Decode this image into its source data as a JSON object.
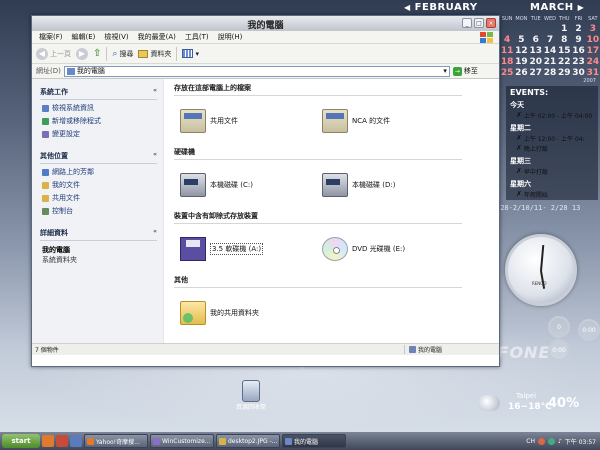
{
  "calendar": {
    "feb": {
      "month": "FEBRUARY"
    },
    "mar": {
      "month": "MARCH",
      "year": "2007",
      "dow": [
        "SUN",
        "MON",
        "TUE",
        "WED",
        "THU",
        "FRI",
        "SAT"
      ],
      "days": [
        "",
        "",
        "",
        "",
        "1",
        "2",
        "3",
        "4",
        "5",
        "6",
        "7",
        "8",
        "9",
        "10",
        "11",
        "12",
        "13",
        "14",
        "15",
        "16",
        "17",
        "18",
        "19",
        "20",
        "21",
        "22",
        "23",
        "24",
        "25",
        "26",
        "27",
        "28",
        "29",
        "30",
        "31"
      ]
    }
  },
  "events": {
    "title": "EVENTS:",
    "groups": [
      {
        "day": "今天",
        "items": [
          "上午 02:00 - 上午 04:00"
        ]
      },
      {
        "day": "星期二",
        "items": [
          "上午 12:00 - 上午 04:",
          "晚上打飯"
        ]
      },
      {
        "day": "星期三",
        "items": [
          "早中打飯"
        ]
      },
      {
        "day": "星期六",
        "items": [
          "年假開始"
        ]
      }
    ]
  },
  "date_strip": "/28-2/10/11- 2/28\n         13",
  "clock": {
    "brand": "RENGO"
  },
  "dials": [
    "0",
    "0:00",
    "0:00"
  ],
  "weather": {
    "city": "Taipei",
    "temp": "16~18°C",
    "humidity": "40%"
  },
  "desktop": {
    "messenger": "Messenger",
    "recycle": "資源回收筒"
  },
  "wall_text": "KOBRI·FONE",
  "window": {
    "title": "我的電腦",
    "menu": [
      "檔案(F)",
      "編輯(E)",
      "檢視(V)",
      "我的最愛(A)",
      "工具(T)",
      "說明(H)"
    ],
    "toolbar": {
      "back": "上一頁",
      "search": "搜尋",
      "folders": "資料夾"
    },
    "address": {
      "label": "網址(D)",
      "value": "我的電腦",
      "go": "移至"
    },
    "tasks": {
      "system": {
        "title": "系統工作",
        "items": [
          "檢視系統資訊",
          "新增或移除程式",
          "變更設定"
        ]
      },
      "other": {
        "title": "其他位置",
        "items": [
          "網路上的芳鄰",
          "我的文件",
          "共用文件",
          "控制台"
        ]
      },
      "details": {
        "title": "詳細資料",
        "name": "我的電腦",
        "desc": "系統資料夾"
      }
    },
    "sections": {
      "files": {
        "title": "存放在這部電腦上的檔案",
        "items": [
          "共用文件",
          "NCA 的文件"
        ]
      },
      "hdd": {
        "title": "硬碟機",
        "items": [
          "本機磁碟 (C:)",
          "本機磁碟 (D:)"
        ]
      },
      "removable": {
        "title": "裝置中含有卸除式存放裝置",
        "items": [
          "3.5 軟碟機 (A:)",
          "DVD 光碟機 (E:)"
        ]
      },
      "other": {
        "title": "其他",
        "items": [
          "我的共用資料夾"
        ]
      }
    },
    "status": {
      "left": "7 個物件",
      "right": "我的電腦"
    }
  },
  "taskbar": {
    "start": "start",
    "tasks": [
      "Yahoo!奇摩搜...",
      "WinCustomize...",
      "desktop2.JPG -...",
      "我的電腦"
    ],
    "tray": {
      "lang": "CH",
      "time": "下午 03:57"
    }
  }
}
